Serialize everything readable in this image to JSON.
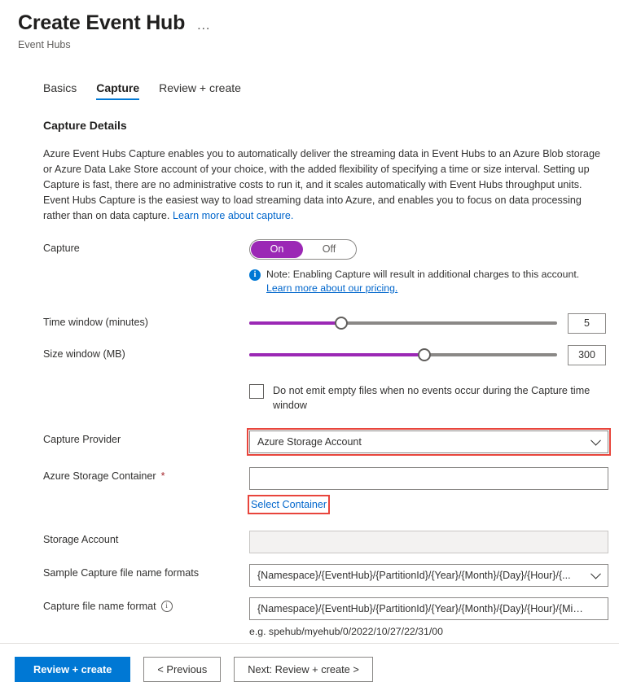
{
  "header": {
    "title": "Create Event Hub",
    "subtitle": "Event Hubs",
    "more_menu": "…"
  },
  "tabs": [
    {
      "label": "Basics",
      "active": false
    },
    {
      "label": "Capture",
      "active": true
    },
    {
      "label": "Review + create",
      "active": false
    }
  ],
  "main": {
    "section_title": "Capture Details",
    "description": "Azure Event Hubs Capture enables you to automatically deliver the streaming data in Event Hubs to an Azure Blob storage or Azure Data Lake Store account of your choice, with the added flexibility of specifying a time or size interval. Setting up Capture is fast, there are no administrative costs to run it, and it scales automatically with Event Hubs throughput units. Event Hubs Capture is the easiest way to load streaming data into Azure, and enables you to focus on data processing rather than on data capture.",
    "description_link": "Learn more about capture.",
    "capture": {
      "label": "Capture",
      "on_label": "On",
      "off_label": "Off",
      "selected": "On",
      "note_text": "Note: Enabling Capture will result in additional charges to this account.",
      "note_link": "Learn more about our pricing.",
      "info_icon": "info-icon"
    },
    "time_window": {
      "label": "Time window (minutes)",
      "value": "5",
      "percent": 30
    },
    "size_window": {
      "label": "Size window (MB)",
      "value": "300",
      "percent": 57
    },
    "do_not_emit": {
      "label": "Do not emit empty files when no events occur during the Capture time window",
      "checked": false
    },
    "capture_provider": {
      "label": "Capture Provider",
      "value": "Azure Storage Account",
      "highlighted": true
    },
    "storage_container": {
      "label": "Azure Storage Container",
      "required_marker": "*",
      "value": "",
      "select_link": "Select Container",
      "link_highlighted": true
    },
    "storage_account": {
      "label": "Storage Account",
      "value": "",
      "readonly": true
    },
    "sample_formats": {
      "label": "Sample Capture file name formats",
      "value": "{Namespace}/{EventHub}/{PartitionId}/{Year}/{Month}/{Day}/{Hour}/{..."
    },
    "file_name_format": {
      "label": "Capture file name format",
      "info_icon": "info-outline-icon",
      "value": "{Namespace}/{EventHub}/{PartitionId}/{Year}/{Month}/{Day}/{Hour}/{Min...",
      "hint": "e.g. spehub/myehub/0/2022/10/27/22/31/00"
    }
  },
  "footer": {
    "review_create": "Review + create",
    "previous": "< Previous",
    "next": "Next: Review + create >"
  },
  "colors": {
    "accent_blue": "#0078d4",
    "link_blue": "#0066cc",
    "toggle_purple": "#9b28b5",
    "highlight_red": "#e8453c",
    "required_red": "#a4262c"
  }
}
